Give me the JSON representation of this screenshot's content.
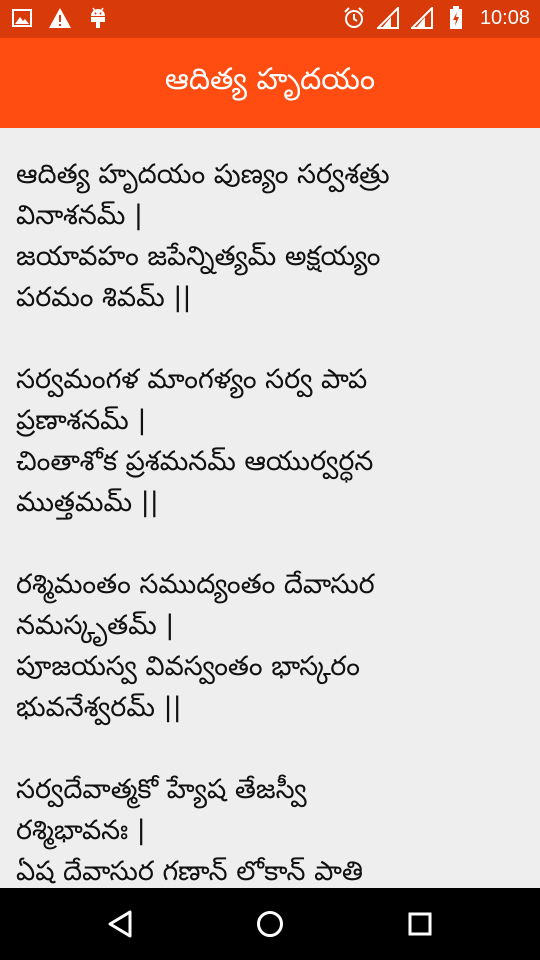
{
  "status_bar": {
    "time": "10:08",
    "icons": [
      "gallery-icon",
      "warning-icon",
      "android-icon",
      "alarm-icon",
      "signal-icon",
      "signal-icon",
      "battery-icon"
    ]
  },
  "app_bar": {
    "title": "ఆదిత్య హృదయం"
  },
  "verses": [
    [
      "ఆదిత్య హృదయం పుణ్యం సర్వశత్రు",
      "వినాశనమ్ |",
      "జయావహం జపేన్నిత్యమ్ అక్షయ్యం",
      "పరమం శివమ్ ||"
    ],
    [
      "సర్వమంగళ మాంగళ్యం సర్వ పాప",
      "ప్రణాశనమ్ |",
      "చింతాశోక ప్రశమనమ్ ఆయుర్వర్ధన",
      "ముత్తమమ్ ||"
    ],
    [
      "రశ్మిమంతం సముద్యంతం దేవాసుర",
      "నమస్కృతమ్ |",
      "పూజయస్వ వివస్వంతం భాస్కరం",
      "భువనేశ్వరమ్ ||"
    ],
    [
      "సర్వదేవాత్మకో హ్యేష తేజస్వీ",
      "రశ్మిభావనః |",
      "ఏష దేవాసుర గణాన్ లోకాన్ పాతి"
    ]
  ],
  "nav_bar": {
    "buttons": [
      "back-icon",
      "home-icon",
      "recents-icon"
    ]
  },
  "colors": {
    "status_bar": "#d83a0a",
    "app_bar": "#ff4d12",
    "background": "#eeeeee",
    "text": "#111111"
  }
}
